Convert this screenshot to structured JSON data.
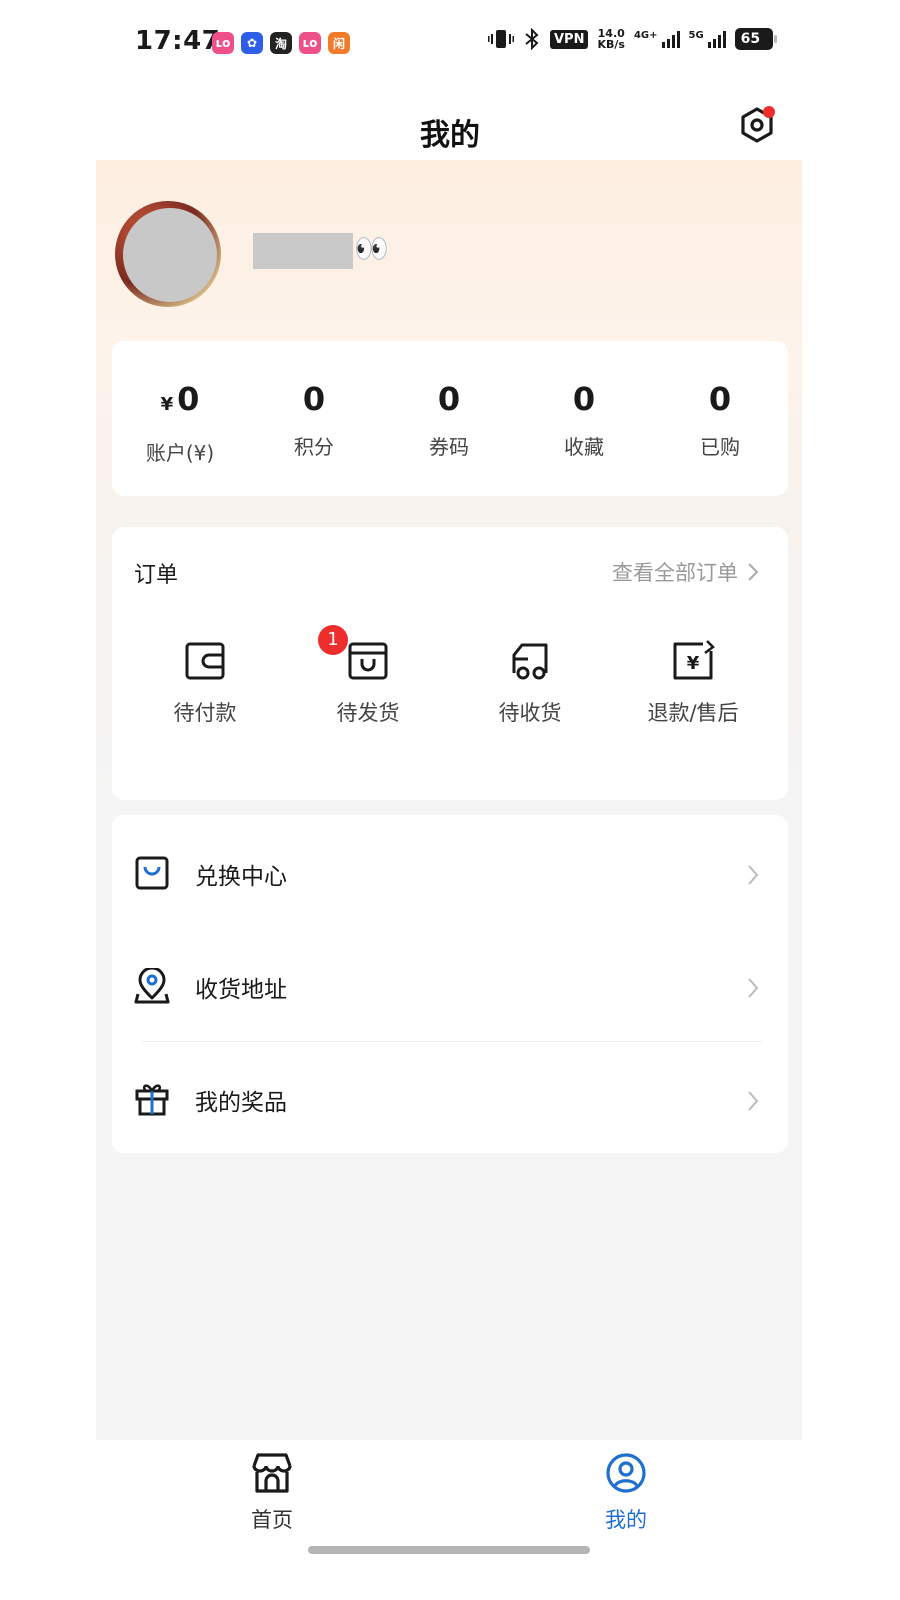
{
  "status_bar": {
    "time": "17:47",
    "app_icons": [
      "lofter-icon",
      "blue-app-icon",
      "taobao-icon",
      "lofter-icon",
      "xianyu-icon"
    ],
    "app_icon_glyphs": [
      "ʟᴏ",
      "✿",
      "淘",
      "ʟᴏ",
      "闲"
    ],
    "vpn": "VPN",
    "net_speed_value": "14.0",
    "net_speed_unit": "KB/s",
    "signal1_label": "4G+",
    "signal2_label": "5G",
    "battery": "65"
  },
  "header": {
    "title": "我的"
  },
  "stats": [
    {
      "value": "0",
      "label": "账户(¥)",
      "currency": "¥"
    },
    {
      "value": "0",
      "label": "积分"
    },
    {
      "value": "0",
      "label": "券码"
    },
    {
      "value": "0",
      "label": "收藏"
    },
    {
      "value": "0",
      "label": "已购"
    }
  ],
  "orders": {
    "title": "订单",
    "view_all": "查看全部订单",
    "items": [
      {
        "label": "待付款",
        "icon": "wallet-icon"
      },
      {
        "label": "待发货",
        "icon": "box-icon",
        "badge": "1"
      },
      {
        "label": "待收货",
        "icon": "truck-icon"
      },
      {
        "label": "退款/售后",
        "icon": "refund-icon"
      }
    ]
  },
  "menu": [
    {
      "label": "兑换中心",
      "icon": "shopping-bag-icon"
    },
    {
      "label": "收货地址",
      "icon": "location-pin-icon"
    },
    {
      "label": "我的奖品",
      "icon": "gift-icon"
    }
  ],
  "tabbar": [
    {
      "label": "首页",
      "icon": "store-icon",
      "active": false
    },
    {
      "label": "我的",
      "icon": "user-circle-icon",
      "active": true
    }
  ],
  "colors": {
    "accent": "#1e6fcf",
    "badge": "#ee2d2d",
    "muted_text": "#999999"
  },
  "profile": {
    "username_emoji": "👀"
  }
}
